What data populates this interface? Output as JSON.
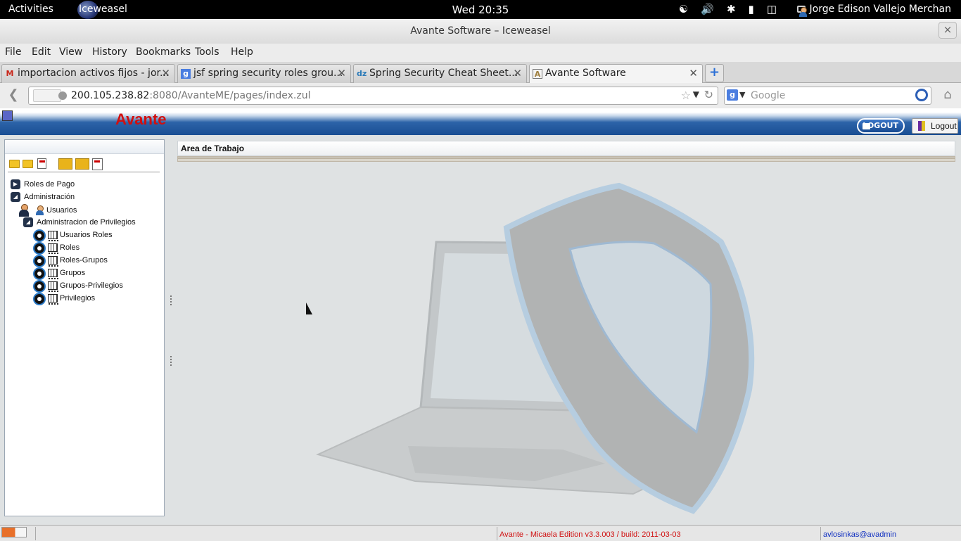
{
  "system_bar": {
    "activities": "Activities",
    "app_name": "Iceweasel",
    "clock": "Wed 20:35",
    "user": "Jorge Edison Vallejo Merchan",
    "tray_icons": [
      "accessibility-icon",
      "volume-icon",
      "bluetooth-icon",
      "signal-icon",
      "battery-icon"
    ]
  },
  "window": {
    "title": "Avante Software – Iceweasel",
    "close": "×"
  },
  "menu": [
    "File",
    "Edit",
    "View",
    "History",
    "Bookmarks",
    "Tools",
    "Help"
  ],
  "tabs": [
    {
      "title": "importacion activos fijos - jor...",
      "favicon": "M",
      "color": "#c8261a"
    },
    {
      "title": "jsf spring security roles grou...",
      "favicon": "g",
      "color": "#4a7de0"
    },
    {
      "title": "Spring Security Cheat Sheet...",
      "favicon": "dz",
      "color": "#2a7ab8"
    },
    {
      "title": "Avante Software",
      "favicon": "A",
      "color": "#a08040"
    }
  ],
  "url": {
    "host": "200.105.238.82",
    "rest": ":8080/AvanteME/pages/index.zul"
  },
  "search": {
    "placeholder": "Google",
    "engine": "g"
  },
  "app": {
    "title": "Avante",
    "logout_pill": "LOGOUT",
    "logout_button": "Logout",
    "work_area_title": "Area de Trabajo"
  },
  "tree": {
    "roles_de_pago": "Roles de Pago",
    "administracion": "Administración",
    "usuarios": "Usuarios",
    "admin_privilegios": "Administracion de Privilegios",
    "children": [
      "Usuarios Roles",
      "Roles",
      "Roles-Grupos",
      "Grupos",
      "Grupos-Privilegios",
      "Privilegios"
    ]
  },
  "status": {
    "version": "Avante - Micaela Edition v3.3.003 / build: 2011-03-03",
    "user": "avlosinkas@avadmin"
  },
  "colors": {
    "brand_red": "#d01010",
    "header_blue": "#1a4e93",
    "link_blue": "#1030c0"
  }
}
